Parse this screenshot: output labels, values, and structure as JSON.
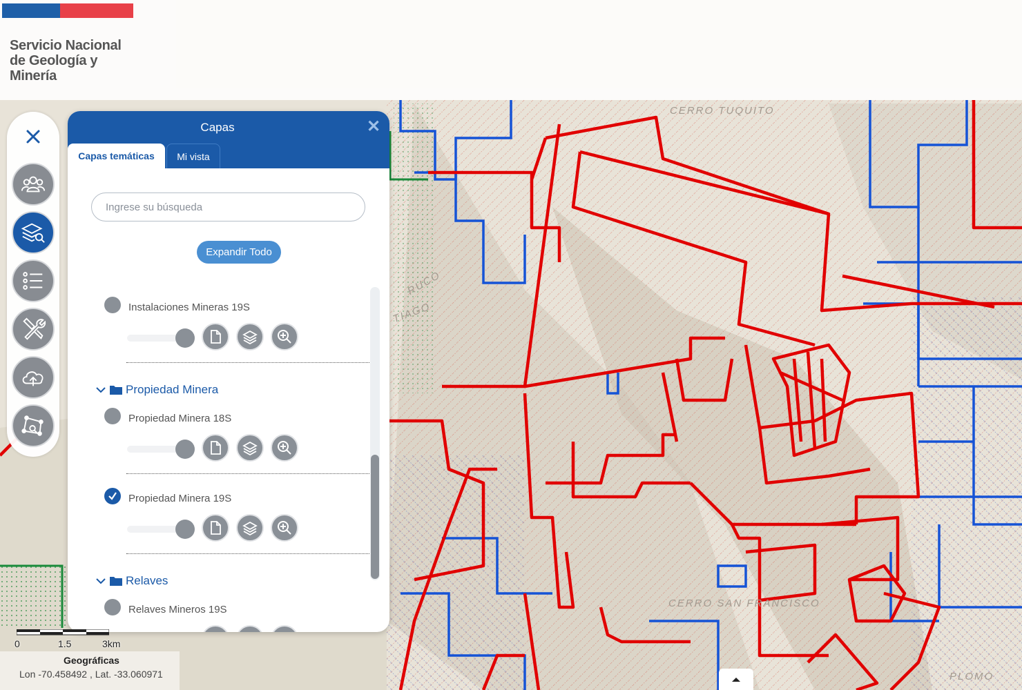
{
  "header": {
    "logo_line1": "Servicio Nacional",
    "logo_line2": "de Geología y",
    "logo_line3": "Minería"
  },
  "toolbar": {
    "items": [
      {
        "icon": "close-icon"
      },
      {
        "icon": "users-icon"
      },
      {
        "icon": "layers-search-icon",
        "active": true
      },
      {
        "icon": "list-icon"
      },
      {
        "icon": "tools-icon"
      },
      {
        "icon": "cloud-upload-icon"
      },
      {
        "icon": "polygon-search-icon"
      }
    ]
  },
  "panel": {
    "title": "Capas",
    "tabs": [
      {
        "label": "Capas temáticas",
        "active": true
      },
      {
        "label": "Mi vista",
        "active": false
      }
    ],
    "search_placeholder": "Ingrese su búsqueda",
    "expand_label": "Expandir Todo",
    "layers": [
      {
        "name": "Instalaciones Mineras 19S",
        "checked": false
      },
      {
        "group": "Propiedad Minera"
      },
      {
        "name": "Propiedad Minera 18S",
        "checked": false
      },
      {
        "name": "Propiedad Minera 19S",
        "checked": true
      },
      {
        "group": "Relaves"
      },
      {
        "name": "Relaves Mineros 19S",
        "checked": false
      }
    ]
  },
  "map": {
    "labels": [
      "CERRO TUQUITO",
      "CERRO SAN FRANCISCO",
      "PLOMO",
      "RUCO",
      "TIAGO",
      "IAGO"
    ],
    "scale": {
      "ticks": [
        "0",
        "1.5",
        "3km"
      ]
    },
    "coords": {
      "title": "Geográficas",
      "text": "Lon -70.458492 , Lat. -33.060971"
    }
  },
  "colors": {
    "primary": "#1b5aa8",
    "claim_red": "#e10000",
    "claim_blue": "#1553d6",
    "claim_green": "#1a8a3a"
  }
}
